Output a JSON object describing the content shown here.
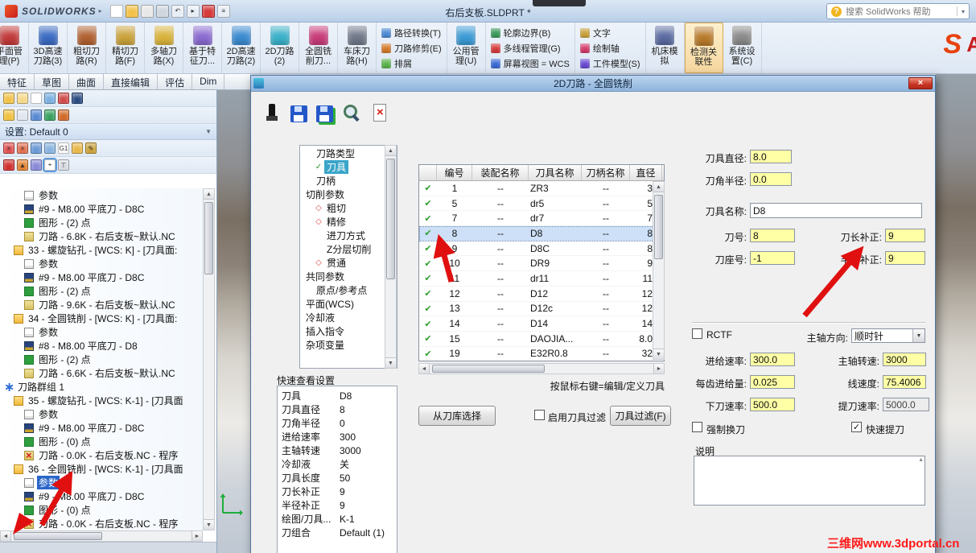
{
  "window": {
    "brand": "SOLIDWORKS",
    "title": "右后支板.SLDPRT *",
    "search_placeholder": "搜索 SolidWorks 帮助",
    "toolbar_icons": [
      {
        "name": "new-document-icon",
        "color": "#ffffff"
      },
      {
        "name": "open-folder-icon",
        "color": "#f2c24a"
      },
      {
        "name": "publish-icon",
        "color": "#e8e8e8"
      },
      {
        "name": "print-preview-icon",
        "color": "#cfd6de"
      },
      {
        "name": "undo-icon",
        "color": "#e8eef6",
        "glyph": "↶"
      },
      {
        "name": "select-cursor-icon",
        "color": "#e8eef6",
        "glyph": "▸"
      },
      {
        "name": "record-icon",
        "color": "#d43a3a"
      },
      {
        "name": "options-menu-icon",
        "color": "#e8eef6",
        "glyph": "≡"
      }
    ]
  },
  "ribbon": {
    "groups": [
      {
        "lines": [
          "平面管",
          "理(P)"
        ],
        "icon": "plane-manage-icon",
        "color": "#c23a3a",
        "cut": true
      },
      {
        "lines": [
          "3D高速",
          "刀路(3)"
        ],
        "icon": "hsm-3d-icon",
        "color": "#3a6ac2"
      },
      {
        "lines": [
          "粗切刀",
          "路(R)"
        ],
        "icon": "rough-path-icon",
        "color": "#b06030"
      },
      {
        "lines": [
          "精切刀",
          "路(F)"
        ],
        "icon": "finish-path-icon",
        "color": "#caa23a"
      },
      {
        "lines": [
          "多轴刀",
          "路(X)"
        ],
        "icon": "multiaxis-path-icon",
        "color": "#d8b23a"
      },
      {
        "lines": [
          "基于特",
          "征刀..."
        ],
        "icon": "feature-based-icon",
        "color": "#8a6ad0"
      },
      {
        "lines": [
          "2D高速",
          "刀路(2)"
        ],
        "icon": "hsm-2d-icon",
        "color": "#3a8ad0"
      },
      {
        "lines": [
          "2D刀路",
          "(2)"
        ],
        "icon": "path-2d-icon",
        "color": "#38b0c8"
      },
      {
        "lines": [
          "全圆铣",
          "削刀..."
        ],
        "icon": "circle-mill-icon",
        "color": "#c83a78"
      },
      {
        "lines": [
          "车床刀",
          "路(H)"
        ],
        "icon": "lathe-path-icon",
        "color": "#707888"
      },
      {
        "rows": [
          {
            "label": "路径转换(T)",
            "icon": "path-convert-icon",
            "color": "#4a8ad4"
          },
          {
            "label": "刀路修剪(E)",
            "icon": "toolpath-trim-icon",
            "color": "#d4782a"
          },
          {
            "label": "排屑",
            "icon": "chip-removal-icon",
            "color": "#5ab44a"
          }
        ]
      },
      {
        "lines": [
          "公用管",
          "理(U)"
        ],
        "icon": "common-manage-icon",
        "color": "#3a9ad4"
      },
      {
        "rows": [
          {
            "label": "轮廓边界(B)",
            "icon": "boundary-icon",
            "color": "#3a9a5a"
          },
          {
            "label": "多线程管理(G)",
            "icon": "multithread-icon",
            "color": "#d43a3a"
          },
          {
            "label": "屏幕视图 = WCS",
            "icon": "screen-view-icon",
            "color": "#3a6ad4"
          }
        ]
      },
      {
        "rows": [
          {
            "label": "文字",
            "icon": "text-icon",
            "color": "#caa23a"
          },
          {
            "label": "绘制轴",
            "icon": "draw-axis-icon",
            "color": "#d43a6a"
          },
          {
            "label": "工件模型(S)",
            "icon": "stock-model-icon",
            "color": "#6a4ad4"
          }
        ]
      },
      {
        "lines": [
          "机床模",
          "拟"
        ],
        "icon": "machine-sim-icon",
        "color": "#5a6aa0"
      },
      {
        "lines": [
          "检测关",
          "联性"
        ],
        "icon": "check-associativity-icon",
        "color": "#b87a2a",
        "selected": true
      },
      {
        "lines": [
          "系统设",
          "置(C)"
        ],
        "icon": "system-settings-icon",
        "color": "#8a8a8a"
      }
    ]
  },
  "tabs": [
    "特征",
    "草图",
    "曲面",
    "直接编辑",
    "评估",
    "Dim"
  ],
  "left_panel": {
    "config_label": "设置: Default 0",
    "icon_rows": [
      [
        {
          "name": "open-folder-icon",
          "color": "#f2c24a"
        },
        {
          "name": "folder-new-icon",
          "color": "#f6d88a"
        },
        {
          "name": "document-icon",
          "color": "#ffffff"
        },
        {
          "name": "split-pane-icon",
          "color": "#7ab0e0"
        },
        {
          "name": "color-wheel-icon",
          "color": "#d04a4a"
        },
        {
          "name": "book-icon",
          "color": "#2a4a80"
        }
      ],
      [
        {
          "name": "folder-stack-icon",
          "color": "#f0c040"
        },
        {
          "name": "layers-icon",
          "color": "#e0e6ee"
        },
        {
          "name": "wrench-icon",
          "color": "#5a8ad4"
        },
        {
          "name": "globe-icon",
          "color": "#3aa060"
        },
        {
          "name": "target-icon",
          "color": "#d06a2a"
        }
      ],
      [
        {
          "name": "delete-icon",
          "color": "#e05050",
          "glyph": "×"
        },
        {
          "name": "delete-all-icon",
          "color": "#e07050",
          "glyph": "×"
        },
        {
          "name": "filter-icon",
          "color": "#6a9ad4"
        },
        {
          "name": "filter-clear-icon",
          "color": "#8ab4e0"
        },
        {
          "name": "g1-code-icon",
          "color": "#ffffff",
          "glyph": "G1"
        },
        {
          "name": "goto-depth-icon",
          "color": "#e8b84a"
        },
        {
          "name": "edit-icon",
          "color": "#caa23a",
          "glyph": "✎"
        }
      ],
      [
        {
          "name": "stop-icon",
          "color": "#d03030"
        },
        {
          "name": "up-arrow-icon",
          "color": "#e08030",
          "glyph": "▲"
        },
        {
          "name": "route-icon",
          "color": "#8a8ad8"
        },
        {
          "name": "pick-position-icon",
          "color": "#eef4fb",
          "selected": true,
          "glyph": "⌖"
        },
        {
          "name": "tee-icon",
          "color": "#d8dce2",
          "glyph": "⊤"
        }
      ]
    ],
    "tree": [
      {
        "indent": 2,
        "icon": "page",
        "label": "参数"
      },
      {
        "indent": 2,
        "icon": "tool",
        "label": "#9 - M8.00 平底刀 - D8C"
      },
      {
        "indent": 2,
        "icon": "pattern",
        "label": "图形 - (2) 点"
      },
      {
        "indent": 2,
        "icon": "toolpath",
        "label": "刀路 - 6.8K - 右后支板~默认.NC"
      },
      {
        "indent": 1,
        "icon": "folder",
        "label": "33 - 螺旋钻孔 - [WCS: K] - [刀具面:"
      },
      {
        "indent": 2,
        "icon": "page",
        "label": "参数"
      },
      {
        "indent": 2,
        "icon": "tool",
        "label": "#9 - M8.00 平底刀 - D8C"
      },
      {
        "indent": 2,
        "icon": "pattern",
        "label": "图形 - (2) 点"
      },
      {
        "indent": 2,
        "icon": "toolpath",
        "label": "刀路 - 9.6K - 右后支板~默认.NC"
      },
      {
        "indent": 1,
        "icon": "folder",
        "label": "34 - 全圆铣削 - [WCS: K] - [刀具面:"
      },
      {
        "indent": 2,
        "icon": "page",
        "label": "参数"
      },
      {
        "indent": 2,
        "icon": "tool",
        "label": "#8 - M8.00 平底刀 - D8"
      },
      {
        "indent": 2,
        "icon": "pattern",
        "label": "图形 - (2) 点"
      },
      {
        "indent": 2,
        "icon": "toolpath",
        "label": "刀路 - 6.6K - 右后支板~默认.NC"
      },
      {
        "indent": 0,
        "icon": "group",
        "label": "刀路群组 1"
      },
      {
        "indent": 1,
        "icon": "folder",
        "label": "35 - 螺旋钻孔 - [WCS: K-1] - [刀具面"
      },
      {
        "indent": 2,
        "icon": "page",
        "label": "参数"
      },
      {
        "indent": 2,
        "icon": "tool",
        "label": "#9 - M8.00 平底刀 - D8C"
      },
      {
        "indent": 2,
        "icon": "pattern",
        "label": "图形 - (0) 点"
      },
      {
        "indent": 2,
        "icon": "toolpath-err",
        "label": "刀路 - 0.0K - 右后支板.NC - 程序"
      },
      {
        "indent": 1,
        "icon": "folder",
        "label": "36 - 全圆铣削 - [WCS: K-1] - [刀具面"
      },
      {
        "indent": 2,
        "icon": "page",
        "label": "参数",
        "selected": true
      },
      {
        "indent": 2,
        "icon": "tool",
        "label": "#9 - M8.00 平底刀 - D8C"
      },
      {
        "indent": 2,
        "icon": "pattern",
        "label": "图形 - (0) 点"
      },
      {
        "indent": 2,
        "icon": "toolpath-err",
        "label": "刀路 - 0.0K - 右后支板.NC - 程序"
      }
    ]
  },
  "dialog": {
    "title": "2D刀路 - 全圆铣削",
    "close_glyph": "×",
    "toolbar_icons": [
      {
        "name": "probe-icon"
      },
      {
        "name": "save-icon"
      },
      {
        "name": "save-as-icon"
      },
      {
        "name": "magnifier-icon"
      },
      {
        "name": "close-doc-icon"
      }
    ],
    "tree": [
      {
        "indent": 1,
        "label": "刀路类型"
      },
      {
        "indent": 1,
        "label": "刀具",
        "selected": true,
        "glyph": "✓",
        "glyph_color": "#2a9a2a"
      },
      {
        "indent": 1,
        "label": "刀柄"
      },
      {
        "indent": 0,
        "label": "切削参数"
      },
      {
        "indent": 1,
        "label": "粗切",
        "glyph": "◇",
        "glyph_color": "#e04848"
      },
      {
        "indent": 1,
        "label": "精修",
        "glyph": "◇",
        "glyph_color": "#e04848"
      },
      {
        "indent": 2,
        "label": "进刀方式"
      },
      {
        "indent": 2,
        "label": "Z分层切削"
      },
      {
        "indent": 1,
        "label": "贯通",
        "glyph": "◇",
        "glyph_color": "#e04848"
      },
      {
        "indent": 0,
        "label": "共同参数"
      },
      {
        "indent": 1,
        "label": "原点/参考点"
      },
      {
        "indent": 0,
        "label": "平面(WCS)"
      },
      {
        "indent": 0,
        "label": "冷却液"
      },
      {
        "indent": 0,
        "label": "插入指令"
      },
      {
        "indent": 0,
        "label": "杂项变量"
      }
    ],
    "table": {
      "columns": [
        "",
        "编号",
        "装配名称",
        "刀具名称",
        "刀柄名称",
        "直径"
      ],
      "rows": [
        {
          "no": "1",
          "asm": "--",
          "tool": "ZR3",
          "holder": "--",
          "dia": "3.0"
        },
        {
          "no": "5",
          "asm": "--",
          "tool": "dr5",
          "holder": "--",
          "dia": "5.0"
        },
        {
          "no": "7",
          "asm": "--",
          "tool": "dr7",
          "holder": "--",
          "dia": "7.0"
        },
        {
          "no": "8",
          "asm": "--",
          "tool": "D8",
          "holder": "--",
          "dia": "8.0",
          "selected": true
        },
        {
          "no": "9",
          "asm": "--",
          "tool": "D8C",
          "holder": "--",
          "dia": "8.0"
        },
        {
          "no": "10",
          "asm": "--",
          "tool": "DR9",
          "holder": "--",
          "dia": "9.0"
        },
        {
          "no": "11",
          "asm": "--",
          "tool": "dr11",
          "holder": "--",
          "dia": "11.0"
        },
        {
          "no": "12",
          "asm": "--",
          "tool": "D12",
          "holder": "--",
          "dia": "12.0"
        },
        {
          "no": "13",
          "asm": "--",
          "tool": "D12c",
          "holder": "--",
          "dia": "12.0"
        },
        {
          "no": "14",
          "asm": "--",
          "tool": "D14",
          "holder": "--",
          "dia": "14.0"
        },
        {
          "no": "15",
          "asm": "--",
          "tool": "DAOJIA...",
          "holder": "--",
          "dia": "8.0..."
        },
        {
          "no": "19",
          "asm": "--",
          "tool": "E32R0.8",
          "holder": "--",
          "dia": "32.0"
        }
      ],
      "hint": "按鼠标右键=编辑/定义刀具"
    },
    "buttons": {
      "from_library": "从刀库选择",
      "enable_filter": "启用刀具过滤",
      "tool_filter": "刀具过滤(F)"
    },
    "quick_view": {
      "title": "快速查看设置",
      "rows": [
        {
          "label": "刀具",
          "value": "D8"
        },
        {
          "label": "刀具直径",
          "value": "8"
        },
        {
          "label": "刀角半径",
          "value": "0"
        },
        {
          "label": "进给速率",
          "value": "300"
        },
        {
          "label": "主轴转速",
          "value": "3000"
        },
        {
          "label": "冷却液",
          "value": "关"
        },
        {
          "label": "刀具长度",
          "value": "50"
        },
        {
          "label": "刀长补正",
          "value": "9"
        },
        {
          "label": "半径补正",
          "value": "9"
        },
        {
          "label": "绘图/刀具...",
          "value": "K-1"
        },
        {
          "label": "刀组合",
          "value": "Default (1)"
        }
      ]
    },
    "fields": {
      "tool_diameter_label": "刀具直径:",
      "tool_diameter": "8.0",
      "corner_radius_label": "刀角半径:",
      "corner_radius": "0.0",
      "tool_name_label": "刀具名称:",
      "tool_name": "D8",
      "tool_no_label": "刀号:",
      "tool_no": "8",
      "length_offset_label": "刀长补正:",
      "length_offset": "9",
      "seat_no_label": "刀座号:",
      "seat_no": "-1",
      "radius_offset_label": "半径补正:",
      "radius_offset": "9",
      "rctf_label": "RCTF",
      "spindle_dir_label": "主轴方向:",
      "spindle_dir": "顺时针",
      "feed_rate_label": "进给速率:",
      "feed_rate": "300.0",
      "spindle_speed_label": "主轴转速:",
      "spindle_speed": "3000",
      "feed_per_tooth_label": "每齿进给量:",
      "feed_per_tooth": "0.025",
      "surface_speed_label": "线速度:",
      "surface_speed": "75.4006",
      "plunge_rate_label": "下刀速率:",
      "plunge_rate": "500.0",
      "retract_rate_label": "提刀速率:",
      "retract_rate": "5000.0",
      "force_tool_change_label": "强制换刀",
      "rapid_retract_label": "快速提刀",
      "description_label": "说明"
    }
  },
  "watermark": "三维网www.3dportal.cn"
}
